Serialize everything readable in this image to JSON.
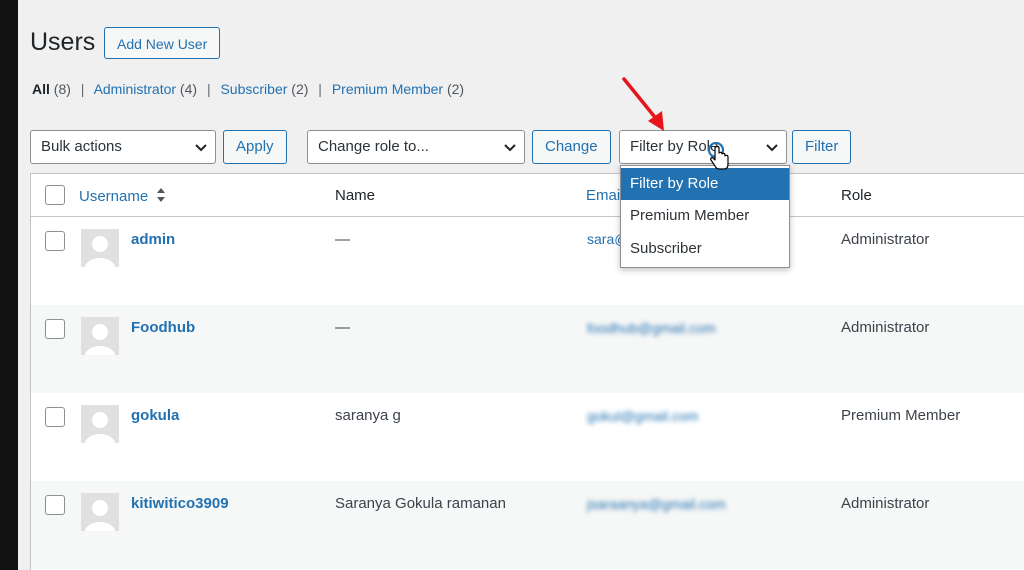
{
  "header": {
    "title": "Users",
    "add_new_label": "Add New User"
  },
  "filters": {
    "all": {
      "label": "All",
      "count": "(8)"
    },
    "administrator": {
      "label": "Administrator",
      "count": "(4)"
    },
    "subscriber": {
      "label": "Subscriber",
      "count": "(2)"
    },
    "premium": {
      "label": "Premium Member",
      "count": "(2)"
    },
    "separator": "|"
  },
  "toolbar": {
    "bulk_actions": "Bulk actions",
    "apply_label": "Apply",
    "change_role": "Change role to...",
    "change_label": "Change",
    "filter_by_role": "Filter by Role",
    "filter_label": "Filter"
  },
  "role_dropdown": {
    "options": [
      "Filter by Role",
      "Premium Member",
      "Subscriber"
    ],
    "selected_index": 0
  },
  "table": {
    "columns": {
      "username": "Username",
      "name": "Name",
      "email": "Email",
      "role": "Role"
    },
    "rows": [
      {
        "username": "admin",
        "name": "—",
        "email": "sara@",
        "role": "Administrator"
      },
      {
        "username": "Foodhub",
        "name": "—",
        "email": "foodhub@gmail.com",
        "role": "Administrator"
      },
      {
        "username": "gokula",
        "name": "saranya g",
        "email": "gokul@gmail.com",
        "role": "Premium Member"
      },
      {
        "username": "kitiwitico3909",
        "name": "Saranya Gokula ramanan",
        "email": "jsaraanya@gmail.com",
        "role": "Administrator"
      }
    ]
  },
  "colors": {
    "accent": "#2271b1",
    "annotation_arrow": "#e8141b"
  }
}
